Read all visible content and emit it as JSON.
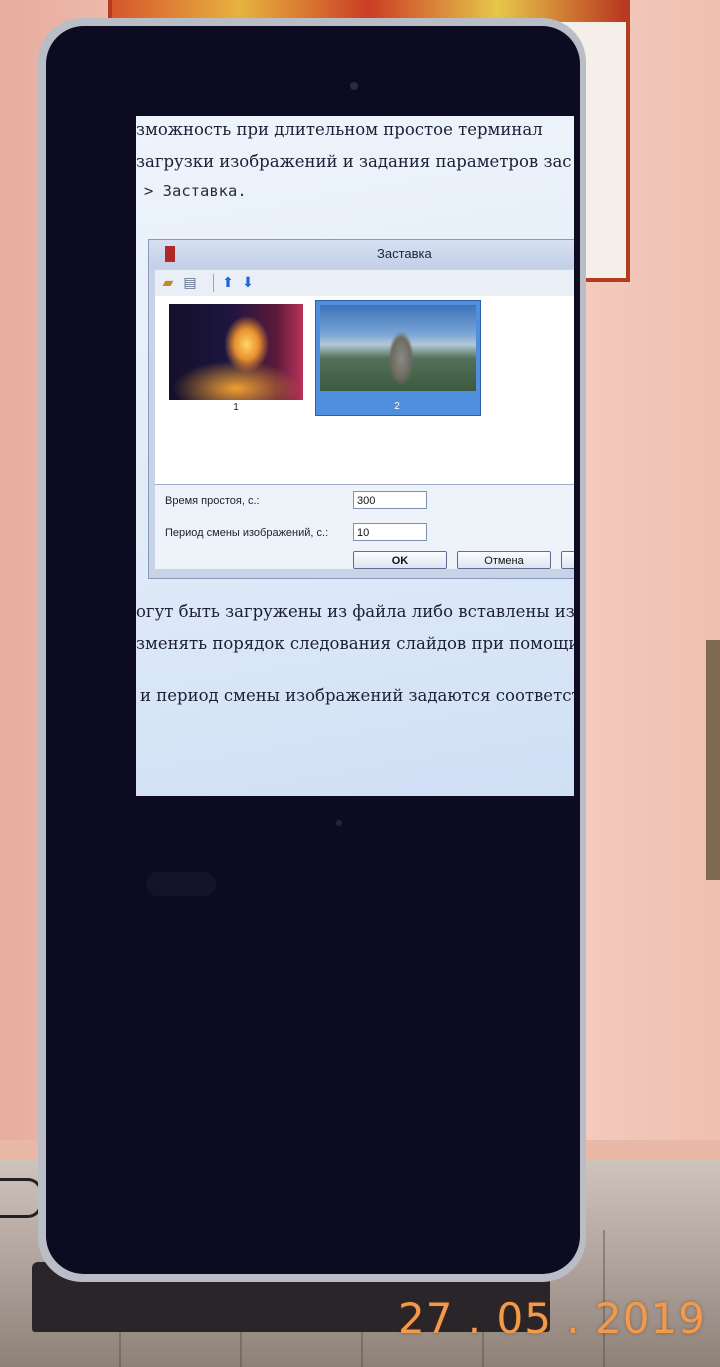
{
  "screen": {
    "doc_lines_top": [
      "зможность при длительном простое терминал",
      "загрузки изображений и задания параметров зас",
      "> Заставка."
    ],
    "dialog": {
      "title": "Заставка",
      "toolbar": {
        "open_icon": "folder-open-icon",
        "paste_icon": "paste-icon",
        "up_icon": "arrow-up-icon",
        "down_icon": "arrow-down-icon"
      },
      "slides": [
        {
          "number": "1",
          "selected": false
        },
        {
          "number": "2",
          "selected": true
        }
      ],
      "idle_label": "Время простоя, с.:",
      "idle_value": "300",
      "period_label": "Период смены изображений, с.:",
      "period_value": "10",
      "ok_label": "OK",
      "cancel_label": "Отмена"
    },
    "doc_lines_bottom": [
      "огут быть загружены из файла либо вставлены из",
      "зменять порядок следования слайдов при помощи",
      "и период смены изображений задаются соответст"
    ]
  },
  "date_stamp": "27 . 05 . 2019",
  "colors": {
    "bezel": "#0d0b22",
    "frame": "#b8bdc6",
    "selection": "#4f8fde",
    "date_stamp": "#f09a4c"
  }
}
